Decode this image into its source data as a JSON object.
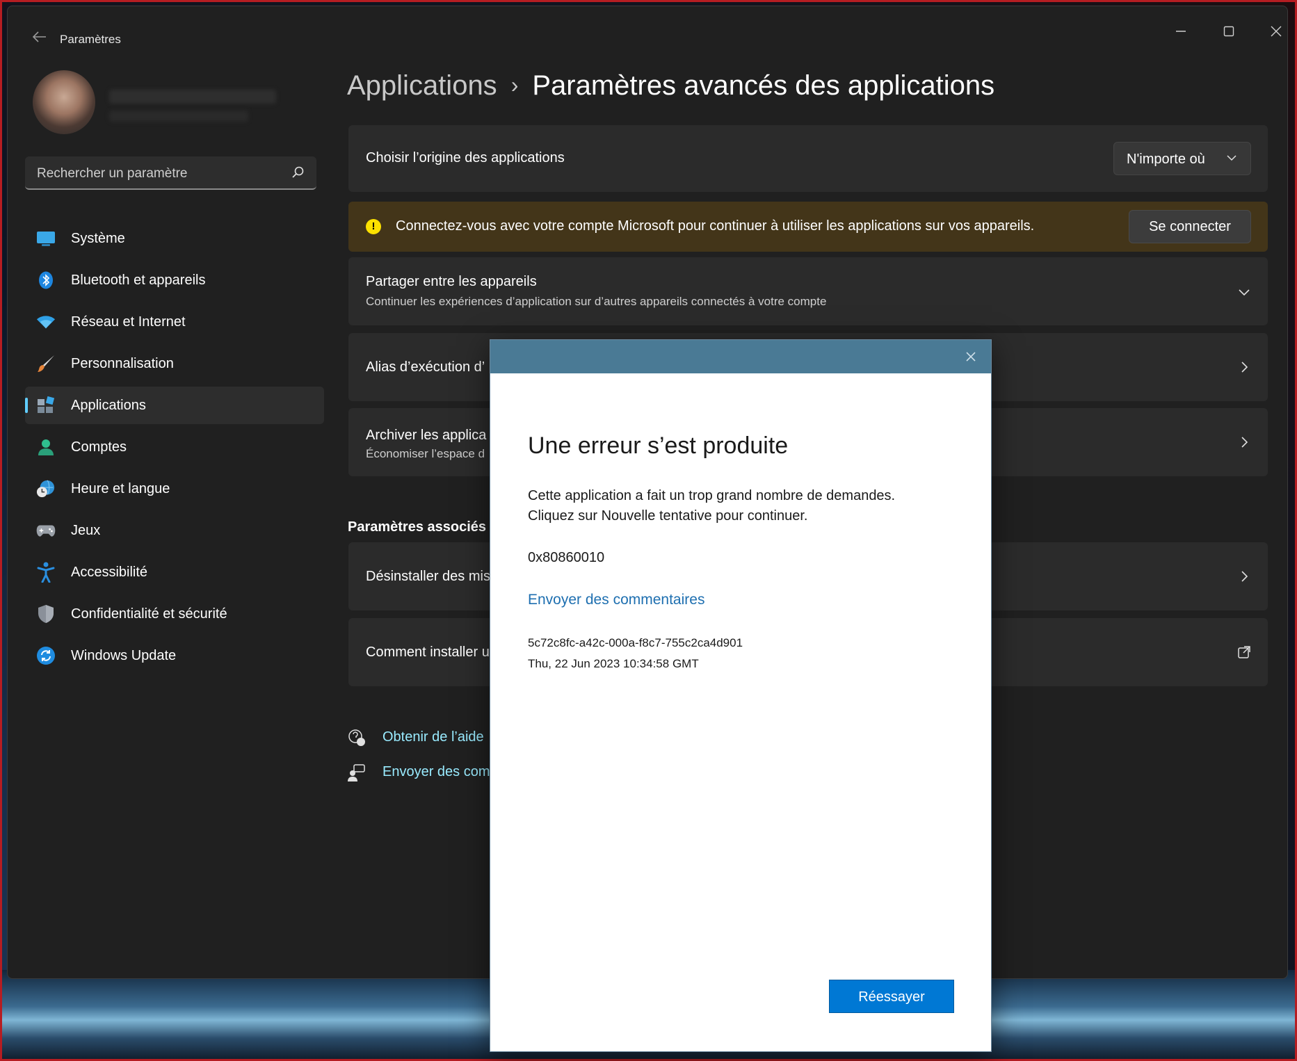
{
  "window": {
    "title": "Paramètres"
  },
  "search": {
    "placeholder": "Rechercher un paramètre"
  },
  "sidebar": {
    "items": [
      {
        "label": "Système",
        "icon": "system-icon"
      },
      {
        "label": "Bluetooth et appareils",
        "icon": "bluetooth-icon"
      },
      {
        "label": "Réseau et Internet",
        "icon": "wifi-icon"
      },
      {
        "label": "Personnalisation",
        "icon": "brush-icon"
      },
      {
        "label": "Applications",
        "icon": "apps-icon",
        "active": true
      },
      {
        "label": "Comptes",
        "icon": "account-icon"
      },
      {
        "label": "Heure et langue",
        "icon": "clock-globe-icon"
      },
      {
        "label": "Jeux",
        "icon": "gamepad-icon"
      },
      {
        "label": "Accessibilité",
        "icon": "accessibility-icon"
      },
      {
        "label": "Confidentialité et sécurité",
        "icon": "shield-icon"
      },
      {
        "label": "Windows Update",
        "icon": "update-icon"
      }
    ]
  },
  "breadcrumb": {
    "parent": "Applications",
    "separator": "›",
    "current": "Paramètres avancés des applications"
  },
  "settings": {
    "origin": {
      "title": "Choisir l’origine des applications",
      "value": "N'importe où"
    },
    "warning": {
      "text": "Connectez-vous avec votre compte Microsoft pour continuer à utiliser les applications sur vos appareils.",
      "button": "Se connecter"
    },
    "share": {
      "title": "Partager entre les appareils",
      "subtitle": "Continuer les expériences d’application sur d’autres appareils connectés à votre compte"
    },
    "alias": {
      "title": "Alias d’exécution d’"
    },
    "archive": {
      "title": "Archiver les applica",
      "subtitle": "Économiser l’espace d"
    }
  },
  "related": {
    "heading": "Paramètres associés",
    "uninstall": "Désinstaller des mis",
    "install": "Comment installer u"
  },
  "links": {
    "help": "Obtenir de l’aide",
    "feedback": "Envoyer des com"
  },
  "dialog": {
    "title": "Une erreur s’est produite",
    "message_line1": "Cette application a fait un trop grand nombre de demandes.",
    "message_line2": "Cliquez sur Nouvelle tentative pour continuer.",
    "error_code": "0x80860010",
    "feedback_link": "Envoyer des commentaires",
    "correlation_id": "5c72c8fc-a42c-000a-f8c7-755c2ca4d901",
    "timestamp": "Thu, 22 Jun 2023 10:34:58 GMT",
    "retry_button": "Réessayer"
  },
  "colors": {
    "accent": "#60cdff",
    "warning_bg": "#433519",
    "dialog_header": "#4a7a95",
    "primary_button": "#0078d4"
  }
}
